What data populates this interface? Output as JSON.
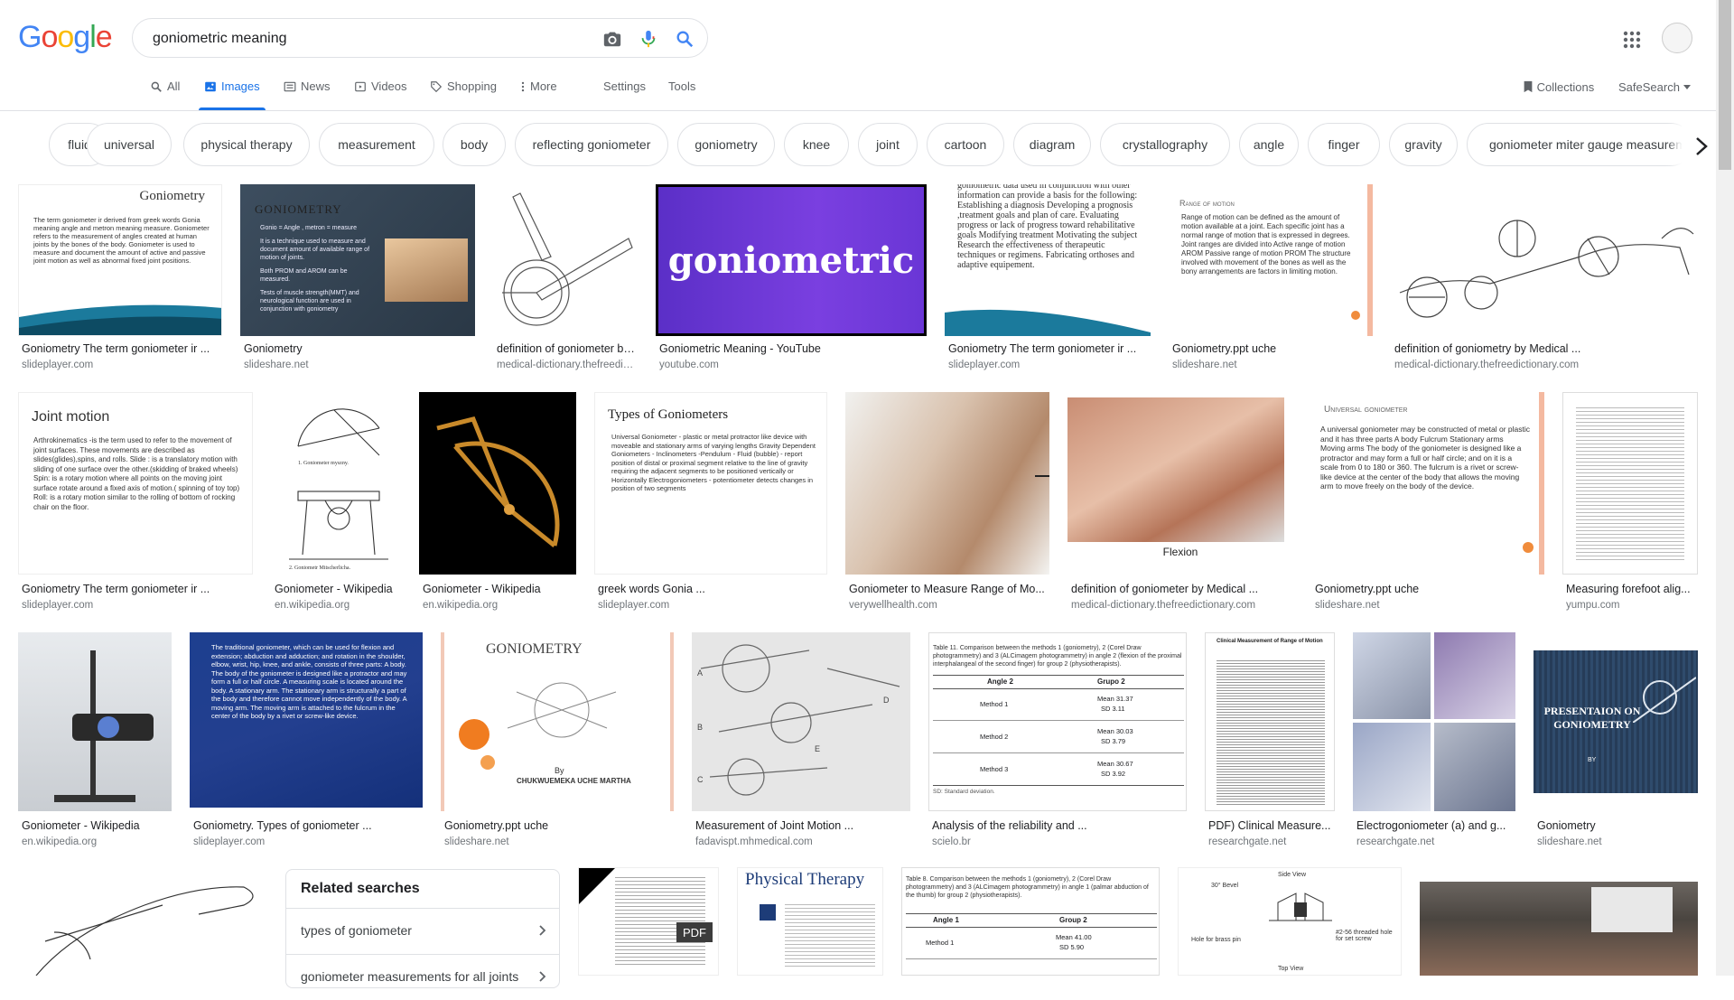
{
  "logo": {
    "letters": [
      "G",
      "o",
      "o",
      "g",
      "l",
      "e"
    ],
    "colors": [
      "#4285f4",
      "#ea4335",
      "#fbbc05",
      "#4285f4",
      "#34a853",
      "#ea4335"
    ]
  },
  "search": {
    "query": "goniometric meaning"
  },
  "icons": {
    "camera": "camera-icon",
    "mic": "microphone-icon",
    "search": "search-icon",
    "apps": "apps-grid-icon"
  },
  "tabs": [
    {
      "label": "All",
      "icon": "search-icon"
    },
    {
      "label": "Images",
      "icon": "image-icon"
    },
    {
      "label": "News",
      "icon": "news-icon"
    },
    {
      "label": "Videos",
      "icon": "video-icon"
    },
    {
      "label": "Shopping",
      "icon": "tag-icon"
    },
    {
      "label": "More",
      "icon": "more-vert-icon"
    },
    {
      "label": "Settings"
    },
    {
      "label": "Tools"
    }
  ],
  "right_tabs": {
    "collections": "Collections",
    "safesearch": "SafeSearch"
  },
  "chips": [
    "fluid",
    "universal",
    "physical therapy",
    "measurement",
    "body",
    "reflecting goniometer",
    "goniometry",
    "knee",
    "joint",
    "cartoon",
    "diagram",
    "crystallography",
    "angle",
    "finger",
    "gravity",
    "goniometer miter gauge measurement"
  ],
  "results": [
    {
      "caption": "Goniometry The term goniometer ir ...",
      "source": "slideplayer.com"
    },
    {
      "caption": "Goniometry",
      "source": "slideshare.net"
    },
    {
      "caption": "definition of goniometer by Medical ...",
      "source": "medical-dictionary.thefreedictionary.com"
    },
    {
      "caption": "Goniometric Meaning - YouTube",
      "source": "youtube.com"
    },
    {
      "caption": "Goniometry The term goniometer ir ...",
      "source": "slideplayer.com"
    },
    {
      "caption": "Goniometry.ppt uche",
      "source": "slideshare.net"
    },
    {
      "caption": "definition of goniometry by Medical ...",
      "source": "medical-dictionary.thefreedictionary.com"
    },
    {
      "caption": "Goniometry The term goniometer ir ...",
      "source": "slideplayer.com"
    },
    {
      "caption": "Goniometer - Wikipedia",
      "source": "en.wikipedia.org"
    },
    {
      "caption": "Goniometer - Wikipedia",
      "source": "en.wikipedia.org"
    },
    {
      "caption": "greek words Gonia ...",
      "source": "slideplayer.com"
    },
    {
      "caption": "Goniometer to Measure Range of Mo...",
      "source": "verywellhealth.com"
    },
    {
      "caption": "definition of goniometer by Medical ...",
      "source": "medical-dictionary.thefreedictionary.com"
    },
    {
      "caption": "Goniometry.ppt uche",
      "source": "slideshare.net"
    },
    {
      "caption": "Measuring forefoot alig...",
      "source": "yumpu.com"
    },
    {
      "caption": "Goniometer - Wikipedia",
      "source": "en.wikipedia.org"
    },
    {
      "caption": "Goniometry. Types of goniometer ...",
      "source": "slideplayer.com"
    },
    {
      "caption": "Goniometry.ppt uche",
      "source": "slideshare.net"
    },
    {
      "caption": "Measurement of Joint Motion ...",
      "source": "fadavispt.mhmedical.com"
    },
    {
      "caption": "Analysis of the reliability and ...",
      "source": "scielo.br"
    },
    {
      "caption": "PDF) Clinical Measure...",
      "source": "researchgate.net"
    },
    {
      "caption": "Electrogoniometer (a) and g...",
      "source": "researchgate.net"
    },
    {
      "caption": "Goniometry",
      "source": "slideshare.net"
    }
  ],
  "thumb_text": {
    "goniometry_title": "Goniometry",
    "goniometry_body": "The term goniometer ir derived from greek words Gonia meaning angle and metron meaning measure. Goniometer refers to the measurement of angles created at human joints by the bones of the body. Goniometer is used to measure and document the amount of active and passive joint motion as well as abnormal fixed joint positions.",
    "goniometry_caps": "GONIOMETRY",
    "goniometry_bullets": [
      "Gonio = Angle , metron = measure",
      "It is a technique used to measure and document amount of available range of motion of joints.",
      "Both PROM and AROM can be measured.",
      "Tests of muscle strength(MMT) and neurological function are used in conjunction with goniometry"
    ],
    "youtube_word": "goniometric",
    "goniometric_data": "goniometric data used in conjunction with other information can provide a basis for the following: Establishing a diagnosis Developing a prognosis ,treatment goals and plan of care. Evaluating progress or lack of progress toward rehabilitative goals Modifying treatment Motivating the subject Research the effectiveness of therapeutic techniques or regimens. Fabricating orthoses and adaptive equipement.",
    "rom_title": "Range of motion",
    "rom_body": "Range of motion can be defined as the amount of motion available at a joint. Each specific joint has a normal range of motion that is expressed in degrees. Joint ranges are divided into Active range of motion AROM Passive range of motion PROM The structure involved with movement of the bones as well as the bony arrangements are factors in limiting motion.",
    "joint_motion_title": "Joint motion",
    "joint_motion_body": "Arthrokinematics -is the term used to refer to the movement of joint surfaces. These movements are described as slides(glides),spins, and rolls. Slide : is a translatory motion with sliding of one surface over the other.(skidding of braked wheels) Spin: is a rotary motion where all points on the moving joint surface rotate around a fixed axis of motion.( spinning of toy top) Roll: is a rotary motion similar to the rolling of bottom of rocking chair on the floor.",
    "types_title": "Types of Goniometers",
    "types_body": "Universal Goniometer - plastic or metal protractor like device with moveable and stationary arms of varying lengths Gravity Dependent Goniometers - Inclinometers -Pendulum - Fluid (bubble) - report position of distal or proximal segment relative to the line of gravity requiring the adjacent segments to be positioned vertically or Horizontally Electrogoniometers - potentiometer detects changes in position of two segments",
    "flexion": "Flexion",
    "universal_title": "Universal goniometer",
    "universal_body": "A universal goniometer may be constructed of metal or plastic and it has three parts A body Fulcrum Stationary arms Moving arms The body of the goniometer is designed like a protractor and may form a full or half circle; and on it is a scale from 0 to 180 or 360. The fulcrum is a rivet or screw-like device at the center of the body that allows the moving arm to move freely on the body of the device.",
    "wiki_fig": "1. Goniometer myszny.",
    "wiki_fig2": "2. Goniometr Mitscherlicha.",
    "types_blue": "The traditional goniometer, which can be used for flexion and extension; abduction and adduction; and rotation in the shoulder, elbow, wrist, hip, knee, and ankle, consists of three parts: A body. The body of the goniometer is designed like a protractor and may form a full or half circle. A measuring scale is located around the body. A stationary arm. The stationary arm is structurally a part of the body and therefore cannot move independently of the body. A moving arm. The moving arm is attached to the fulcrum in the center of the body by a rivet or screw-like device.",
    "goniometry_orange_title": "GONIOMETRY",
    "goniometry_orange_by": "By",
    "goniometry_orange_name": "CHUKWUEMEKA UCHE MARTHA",
    "table11_caption": "Table 11. Comparison between the methods 1 (goniometry), 2 (Corel Draw photogrammetry) and 3 (ALCimagem photogrammetry) in angle 2 (flexion of the proximal interphalangeal of the second finger) for group 2 (physiotherapists).",
    "table11_head": [
      "Angle 2",
      "Grupo 2"
    ],
    "table11_rows": [
      [
        "Method 1",
        "Mean 31.37",
        "SD 3.11"
      ],
      [
        "Method 2",
        "Mean 30.03",
        "SD 3.79"
      ],
      [
        "Method 3",
        "Mean 30.67",
        "SD 3.92"
      ]
    ],
    "table11_note": "SD: Standard deviation.",
    "clinical_title": "Clinical Measurement of Range of Motion",
    "presentation": "PRESENTAION ON GONIOMETRY",
    "presentation_by": "BY",
    "pdf_badge": "PDF",
    "pt_title": "Physical Therapy",
    "table8_caption": "Table 8. Comparison between the methods 1 (goniometry), 2 (Corel Draw photogrammetry) and 3 (ALCimagem photogrammetry) in angle 1 (palmar abduction of the thumb) for group 2 (physiotherapists).",
    "table8_head": [
      "Angle 1",
      "Group 2"
    ],
    "table8_row": [
      "Method 1",
      "Mean 41.00",
      "SD 5.90"
    ],
    "side_view": "Side View",
    "top_view": "Top View",
    "bevel": "30° Bevel",
    "hole": "Hole for brass pin",
    "thread": "#2-56 threaded hole for set screw",
    "table_letters": [
      "A",
      "B",
      "C",
      "D",
      "E"
    ]
  },
  "related": {
    "title": "Related searches",
    "items": [
      "types of goniometer",
      "goniometer measurements for all joints"
    ]
  }
}
